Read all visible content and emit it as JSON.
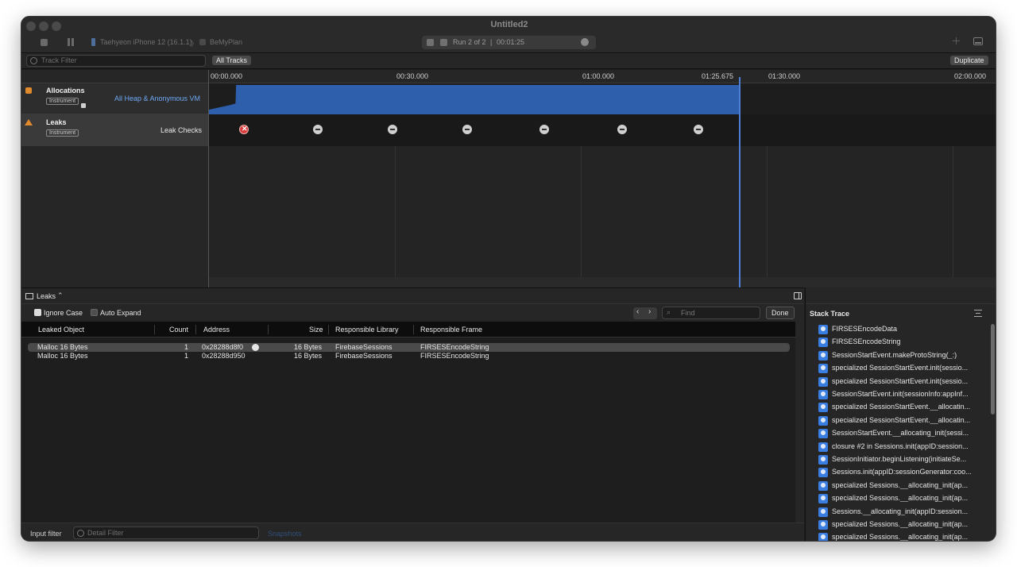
{
  "window": {
    "title": "Untitled2"
  },
  "toolbar": {
    "device": "Taehyeon iPhone 12 (16.1.1)",
    "separator": "〉",
    "app": "BeMyPlan",
    "run": "Run 2 of 2",
    "run_sep": "|",
    "elapsed": "00:01:25"
  },
  "filterbar": {
    "track_filter_placeholder": "Track Filter",
    "all_tracks": "All Tracks",
    "duplicate": "Duplicate"
  },
  "ruler": {
    "ticks": [
      "00:00.000",
      "00:30.000",
      "01:00.000",
      "01:25.675",
      "01:30.000",
      "02:00.000"
    ]
  },
  "tracks": [
    {
      "name": "Allocations",
      "badge": "Instrument",
      "detail": "All Heap & Anonymous VM"
    },
    {
      "name": "Leaks",
      "badge": "Instrument",
      "detail": "Leak Checks"
    }
  ],
  "leak_checks": [
    {
      "status": "leak"
    },
    {
      "status": "ok"
    },
    {
      "status": "ok"
    },
    {
      "status": "ok"
    },
    {
      "status": "ok"
    },
    {
      "status": "ok"
    },
    {
      "status": "ok"
    }
  ],
  "detail": {
    "selector": "Leaks",
    "ignore_case": "Ignore Case",
    "auto_expand": "Auto Expand",
    "find_placeholder": "Find",
    "done": "Done",
    "columns": [
      "Leaked Object",
      "Count",
      "Address",
      "Size",
      "Responsible Library",
      "Responsible Frame"
    ],
    "rows": [
      {
        "object": "Malloc 16 Bytes",
        "count": "1",
        "address": "0x28288d8f0",
        "size": "16 Bytes",
        "library": "FirebaseSessions",
        "frame": "FIRSESEncodeString"
      },
      {
        "object": "Malloc 16 Bytes",
        "count": "1",
        "address": "0x28288d950",
        "size": "16 Bytes",
        "library": "FirebaseSessions",
        "frame": "FIRSESEncodeString"
      }
    ],
    "input_filter": "Input filter",
    "detail_filter_placeholder": "Detail Filter",
    "snapshots": "Snapshots"
  },
  "stack": {
    "title": "Stack Trace",
    "frames": [
      "FIRSESEncodeData",
      "FIRSESEncodeString",
      "SessionStartEvent.makeProtoString(_:)",
      "specialized SessionStartEvent.init(sessio...",
      "specialized SessionStartEvent.init(sessio...",
      "SessionStartEvent.init(sessionInfo:appInf...",
      "specialized SessionStartEvent.__allocatin...",
      "specialized SessionStartEvent.__allocatin...",
      "SessionStartEvent.__allocating_init(sessi...",
      "closure #2 in Sessions.init(appID:session...",
      "SessionInitiator.beginListening(initiateSe...",
      "Sessions.init(appID:sessionGenerator:coo...",
      "specialized Sessions.__allocating_init(ap...",
      "specialized Sessions.__allocating_init(ap...",
      "Sessions.__allocating_init(appID:session...",
      "specialized Sessions.__allocating_init(ap...",
      "specialized Sessions.__allocating_init(ap..."
    ]
  },
  "colors": {
    "allocations_fill": "#2d5fad",
    "leak_red": "#d93a3a",
    "accent_link": "#6ea8f5"
  }
}
